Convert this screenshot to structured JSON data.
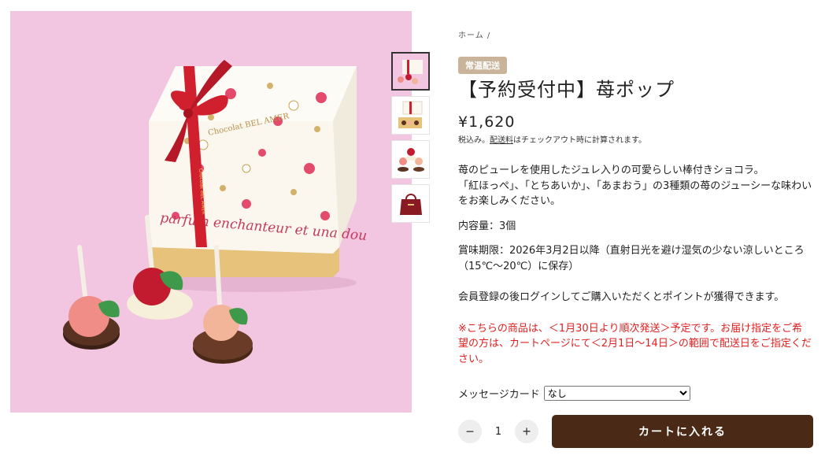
{
  "breadcrumb": "ホーム /",
  "badge": "常温配送",
  "title": "【予約受付中】苺ポップ",
  "price": "¥1,620",
  "tax": {
    "prefix": "税込み。",
    "link": "配送料",
    "suffix": "はチェックアウト時に計算されます。"
  },
  "image_text": {
    "brand": "Chocolat BEL AMER",
    "script": "parfum enchanteur et una dou",
    "ribbon": "Chocolat BEL AMER"
  },
  "description": {
    "line1": "苺のピューレを使用したジュレ入りの可愛らしい棒付きショコラ。",
    "line2": "「紅ほっぺ」、「とちあいか」、「あまおう」の3種類の苺のジューシーな味わいをお楽しみください。",
    "contents": "内容量：3個",
    "expiry": "賞味期限：2026年3月2日以降（直射日光を避け湿気の少ない涼しいところ（15℃～20℃）に保存）",
    "member": "会員登録の後ログインしてご購入いただくとポイントが獲得できます。",
    "notice": "※こちらの商品は、＜1月30日より順次発送＞予定です。お届け指定をご希望の方は、カートページにて＜2月1日～14日＞の範囲で配送日をご指定ください。"
  },
  "message_card": {
    "label": "メッセージカード",
    "selected": "なし"
  },
  "quantity": {
    "minus": "−",
    "value": "1",
    "plus": "+"
  },
  "cart_button": "カートに入れる",
  "colors": {
    "background_pink": "#f2c6e0",
    "cart_button": "#4a2916",
    "badge": "#c9b49b",
    "notice": "#e02020"
  }
}
